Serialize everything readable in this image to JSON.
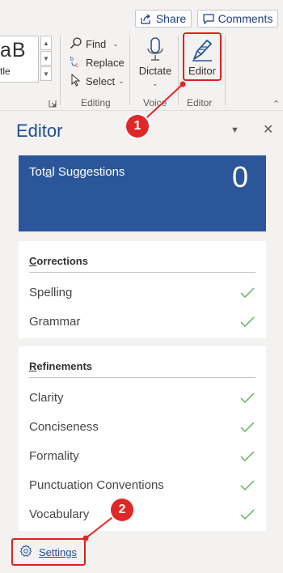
{
  "ribbon": {
    "share_label": "Share",
    "comments_label": "Comments",
    "style_preview": "aB",
    "style_name": "tle",
    "editing": {
      "find_label": "Find",
      "replace_label": "Replace",
      "select_label": "Select",
      "group_label": "Editing"
    },
    "voice": {
      "dictate_label": "Dictate",
      "group_label": "Voice"
    },
    "editor_group": {
      "editor_label": "Editor",
      "group_label": "Editor"
    }
  },
  "callouts": {
    "first": "1",
    "second": "2"
  },
  "editor_pane": {
    "title": "Editor",
    "summary": {
      "label_before": "Tot",
      "label_underlined": "a",
      "label_after": "l Suggestions",
      "count": "0"
    },
    "corrections": {
      "heading_underlined": "C",
      "heading_rest": "orrections",
      "items": [
        {
          "label": "Spelling"
        },
        {
          "label": "Grammar"
        }
      ]
    },
    "refinements": {
      "heading_underlined": "R",
      "heading_rest": "efinements",
      "items": [
        {
          "label": "Clarity"
        },
        {
          "label": "Conciseness"
        },
        {
          "label": "Formality"
        },
        {
          "label": "Punctuation Conventions"
        },
        {
          "label": "Vocabulary"
        }
      ]
    },
    "settings_label": "Settings"
  },
  "colors": {
    "accent": "#2b579a",
    "title_blue": "#1e4e96",
    "check_green": "#58b258",
    "callout_red": "#e02727"
  }
}
